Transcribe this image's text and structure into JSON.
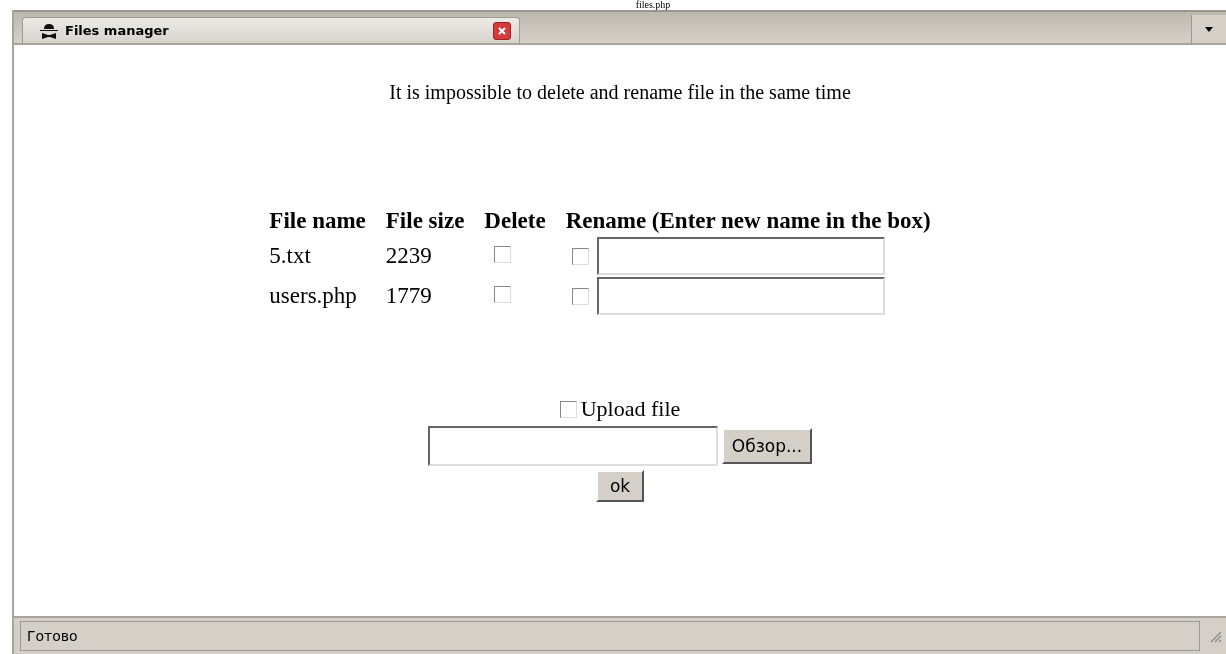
{
  "window": {
    "title": "files.php"
  },
  "tabs": [
    {
      "label": "Files manager",
      "selected": true
    }
  ],
  "message": "It is impossible to delete and rename file in the same time",
  "table": {
    "columns": [
      "File name",
      "File size",
      "Delete",
      "Rename (Enter new name in the box)"
    ],
    "rows": [
      {
        "name": "5.txt",
        "size": "2239",
        "delete_checked": false,
        "rename_checked": false
      },
      {
        "name": "users.php",
        "size": "1779",
        "delete_checked": false,
        "rename_checked": false
      }
    ]
  },
  "upload": {
    "label": "Upload file",
    "checked": false,
    "browse_button": "Обзор...",
    "submit_button": "ok"
  },
  "status_bar": "Готово"
}
